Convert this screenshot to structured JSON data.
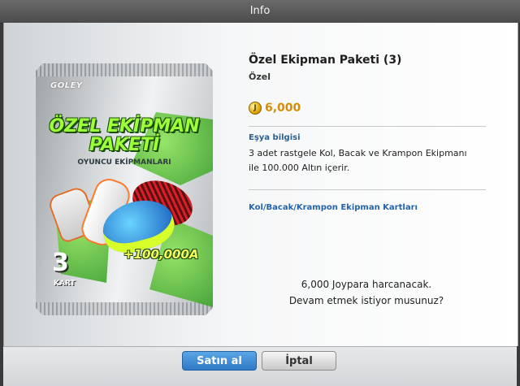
{
  "window": {
    "title": "Info"
  },
  "item": {
    "name": "Özel Ekipman Paketi (3)",
    "category": "Özel",
    "price": "6,000",
    "info_label": "Eşya bilgisi",
    "info_text_line1": "3 adet rastgele Kol, Bacak ve Krampon Ekipmanı",
    "info_text_line2": "ile 100.000 Altın içerir.",
    "link_text": "Kol/Bacak/Krampon Ekipman Kartları"
  },
  "card": {
    "logo": "GOLEY",
    "title_line1": "ÖZEL EKİPMAN",
    "title_line2": "PAKETİ",
    "subtitle": "OYUNCU EKİPMANLARI",
    "bonus": "+100,000A",
    "count": "3",
    "count_label": "KART"
  },
  "confirm": {
    "line1": "6,000 Joypara harcanacak.",
    "line2": "Devam etmek istiyor musunuz?"
  },
  "buttons": {
    "buy": "Satın al",
    "cancel": "İptal"
  },
  "colors": {
    "accent": "#2f78c4",
    "price": "#d88d00",
    "link": "#2563a8"
  },
  "icons": {
    "coin": "coin-icon"
  }
}
